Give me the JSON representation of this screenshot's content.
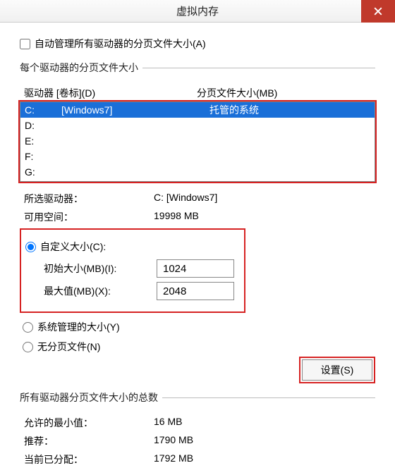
{
  "window": {
    "title": "虚拟内存"
  },
  "auto_manage": {
    "label": "自动管理所有驱动器的分页文件大小(A)",
    "checked": false
  },
  "per_drive": {
    "legend": "每个驱动器的分页文件大小",
    "header_drive": "驱动器 [卷标](D)",
    "header_size": "分页文件大小(MB)",
    "rows": [
      {
        "drive": "C:",
        "label": "[Windows7]",
        "size": "托管的系统",
        "selected": true
      },
      {
        "drive": "D:",
        "label": "",
        "size": "",
        "selected": false
      },
      {
        "drive": "E:",
        "label": "",
        "size": "",
        "selected": false
      },
      {
        "drive": "F:",
        "label": "",
        "size": "",
        "selected": false
      },
      {
        "drive": "G:",
        "label": "",
        "size": "",
        "selected": false
      }
    ],
    "selected_drive_label": "所选驱动器：",
    "selected_drive_value": "C: [Windows7]",
    "free_space_label": "可用空间：",
    "free_space_value": "19998 MB"
  },
  "size_mode": {
    "custom_label": "自定义大小(C):",
    "initial_label": "初始大小(MB)(I):",
    "initial_value": "1024",
    "max_label": "最大值(MB)(X):",
    "max_value": "2048",
    "system_label": "系统管理的大小(Y)",
    "none_label": "无分页文件(N)",
    "selected": "custom",
    "set_button": "设置(S)"
  },
  "totals": {
    "legend": "所有驱动器分页文件大小的总数",
    "min_label": "允许的最小值：",
    "min_value": "16 MB",
    "rec_label": "推荐：",
    "rec_value": "1790 MB",
    "cur_label": "当前已分配：",
    "cur_value": "1792 MB"
  }
}
